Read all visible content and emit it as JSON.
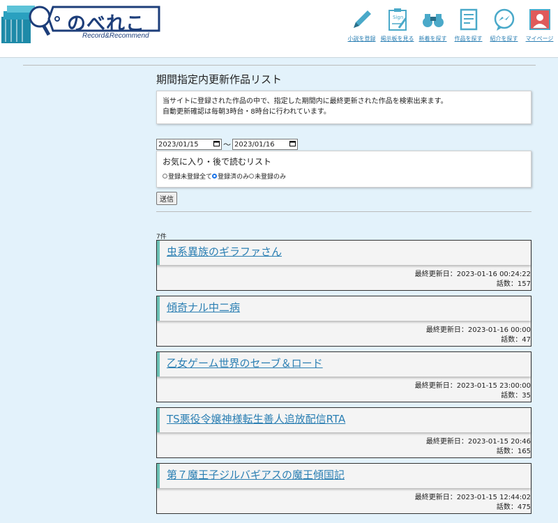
{
  "header": {
    "logo": {
      "brand": "のべれこ",
      "tagline": "Record&Recommend"
    },
    "nav": [
      {
        "label": "小説を登録",
        "icon": "pencil-icon"
      },
      {
        "label": "掲示板を見る",
        "icon": "sign-board-icon"
      },
      {
        "label": "新着を探す",
        "icon": "binoculars-icon"
      },
      {
        "label": "作品を探す",
        "icon": "document-icon"
      },
      {
        "label": "紹介を探す",
        "icon": "chat-icon"
      },
      {
        "label": "マイページ",
        "icon": "user-icon"
      }
    ]
  },
  "main": {
    "title": "期間指定内更新作品リスト",
    "desc_line1": "当サイトに登録された作品の中で、指定した期間内に最終更新された作品を検索出来ます。",
    "desc_line2": "自動更新確認は毎朝3時台・8時台に行われています。",
    "date_from": "2023/01/15",
    "tilde": "～",
    "date_to": "2023/01/16",
    "fav_title": "お気に入り・後で読むリスト",
    "radio_options": [
      "登録未登録全て",
      "登録済のみ",
      "未登録のみ"
    ],
    "radio_selected": "登録済のみ",
    "submit_label": "送信",
    "count": "7件",
    "works": [
      {
        "title": "虫系異族のギラファさん",
        "updated": "最終更新日：2023-01-16 00:24:22",
        "episodes": "話数：157"
      },
      {
        "title": "傾奇ナル中二病",
        "updated": "最終更新日：2023-01-16 00:00",
        "episodes": "話数：47"
      },
      {
        "title": "乙女ゲーム世界のセーブ＆ロード",
        "updated": "最終更新日：2023-01-15 23:00:00",
        "episodes": "話数：35"
      },
      {
        "title": "TS悪役令嬢神様転生善人追放配信RTA",
        "updated": "最終更新日：2023-01-15 20:46",
        "episodes": "話数：165"
      },
      {
        "title": "第７魔王子ジルバギアスの魔王傾国記",
        "updated": "最終更新日：2023-01-15 12:44:02",
        "episodes": "話数：475"
      }
    ]
  }
}
